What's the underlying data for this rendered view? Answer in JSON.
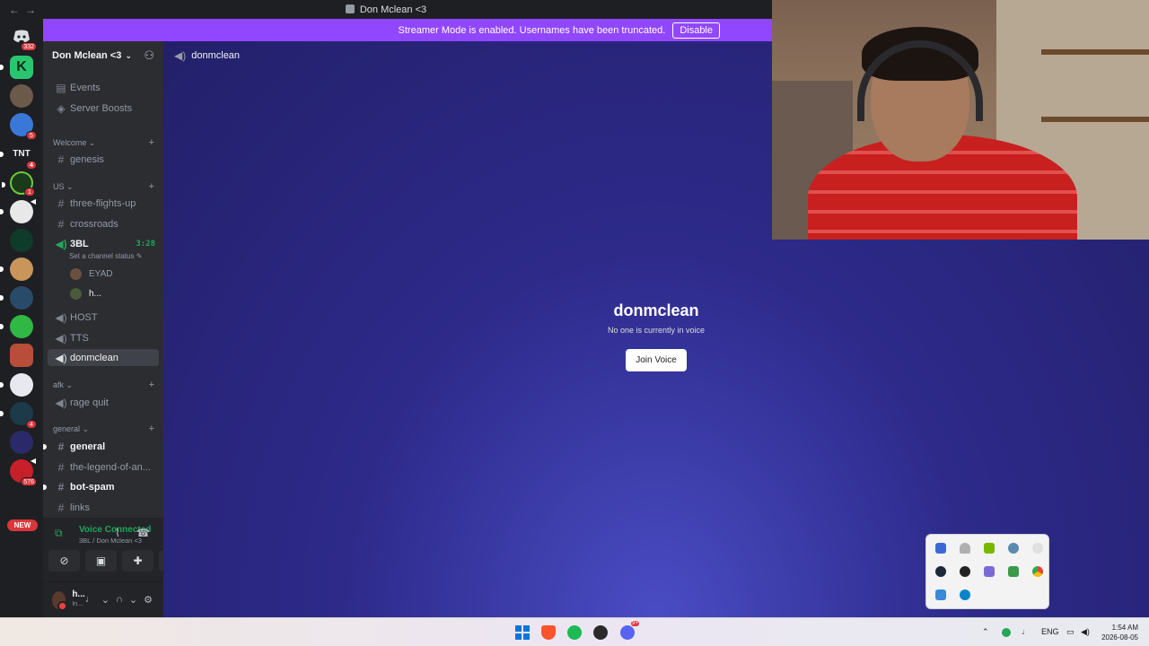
{
  "window": {
    "title": "Don Mclean <3",
    "nav_back": "←",
    "nav_forward": "→"
  },
  "banner": {
    "text": "Streamer Mode is enabled. Usernames have been truncated.",
    "button": "Disable"
  },
  "rail": {
    "home_badge": "332",
    "badges": [
      "5",
      "4",
      "1",
      "4",
      "576"
    ],
    "new_label": "NEW",
    "server_glyphs": {
      "k": "K",
      "tnt": "TNT"
    }
  },
  "guild": {
    "name": "Don Mclean <3",
    "caret": "⌄"
  },
  "nav": {
    "events": "Events",
    "boosts": "Server Boosts"
  },
  "categories": {
    "welcome": "Welcome",
    "us": "US",
    "afk": "afk",
    "general": "general"
  },
  "channels": {
    "genesis": "genesis",
    "three_flights_up": "three-flights-up",
    "crossroads": "crossroads",
    "bl3": "3BL",
    "bl3_timer": "3:28",
    "bl3_status": "Set a channel status",
    "host": "HOST",
    "tts": "TTS",
    "donmclean": "donmclean",
    "rage_quit": "rage quit",
    "general": "general",
    "legend": "the-legend-of-an...",
    "bot_spam": "bot-spam",
    "links": "links"
  },
  "members": {
    "eyad": "EYAD",
    "h": "h..."
  },
  "voice": {
    "title": "Voice Connected",
    "sub": "3BL / Don Mclean <3"
  },
  "user": {
    "name": "h...",
    "status": "In..."
  },
  "main": {
    "channel": "donmclean",
    "empty_title": "donmclean",
    "empty_sub": "No one is currently in voice",
    "join_button": "Join Voice"
  },
  "taskbar": {
    "lang": "ENG",
    "time": "1:54 AM",
    "date": "2026-08-05",
    "discord_badge": "9+"
  },
  "colors": {
    "accent": "#9147ff",
    "online": "#23a55a",
    "danger": "#da373c"
  }
}
